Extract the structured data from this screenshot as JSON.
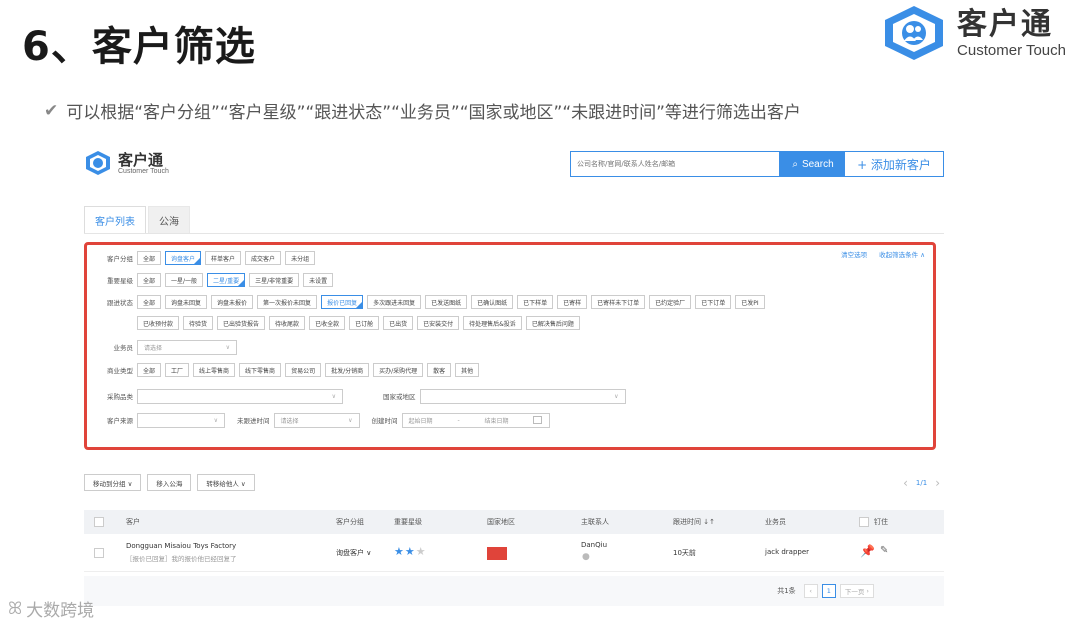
{
  "slide": {
    "title": "6、客户筛选",
    "subtitle": "可以根据“客户分组”“客户星级”“跟进状态”“业务员”“国家或地区”“未跟进时间”等进行筛选出客户",
    "brand_cn": "客户通",
    "brand_en": "Customer Touch",
    "watermark": "大数跨境"
  },
  "app": {
    "logo_cn": "客户通",
    "logo_en": "Customer Touch",
    "search_placeholder": "公司名称/官网/联系人姓名/邮箱",
    "search_button": "Search",
    "add_button": "+ 添加新客户",
    "tabs": [
      "客户列表",
      "公海"
    ],
    "links": {
      "clear": "清空选项",
      "collapse": "收起筛选条件 ∧"
    }
  },
  "filters": {
    "group": {
      "label": "客户分组",
      "options": [
        "全部",
        "询盘客户",
        "样单客户",
        "成交客户",
        "未分组"
      ],
      "selected": 1
    },
    "star": {
      "label": "重要星级",
      "options": [
        "全部",
        "一星/一般",
        "二星/重要",
        "三星/非常重要",
        "未设置"
      ],
      "selected": 2
    },
    "status": {
      "label": "跟进状态",
      "options1": [
        "全部",
        "询盘未回复",
        "询盘未报价",
        "第一次报价未回复",
        "报价已回复",
        "多次跟进未回复",
        "已发送图纸",
        "已确认图纸",
        "已下样单",
        "已寄样",
        "已寄样未下订单",
        "已约定验厂",
        "已下订单",
        "已发PI"
      ],
      "options2": [
        "已收预付款",
        "待验货",
        "已出验货报告",
        "待收尾款",
        "已收全款",
        "已订舱",
        "已出货",
        "已安装交付",
        "待处理售后&投诉",
        "已解决售后问题"
      ],
      "selected": 4
    },
    "sales": {
      "label": "业务员",
      "placeholder": "请选择"
    },
    "business": {
      "label": "商业类型",
      "options": [
        "全部",
        "工厂",
        "线上零售商",
        "线下零售商",
        "贸易公司",
        "批发/分销商",
        "买办/采购代理",
        "散客",
        "其他"
      ]
    },
    "purchase": {
      "label": "采购品类"
    },
    "country": {
      "label": "国家或地区"
    },
    "source": {
      "label": "客户来源"
    },
    "no_follow": {
      "label": "未跟进时间",
      "placeholder": "请选择"
    },
    "created": {
      "label": "创建时间",
      "start": "起始日期",
      "sep": "-",
      "end": "结束日期"
    }
  },
  "toolbar": {
    "move_group": "移动到分组 ∨",
    "move_public": "移入公海",
    "transfer": "转移给他人 ∨",
    "page": "1/1"
  },
  "table": {
    "headers": [
      "客户",
      "客户分组",
      "重要星级",
      "国家地区",
      "主联系人",
      "跟进时间 ↓↑",
      "业务员",
      "钉住"
    ],
    "row": {
      "company": "Dongguan Misaiou Toys Factory",
      "note": "［报价已回复］我的报价他已经回复了",
      "group": "询盘客户 ∨",
      "stars": 2,
      "contact": "DanQiu",
      "follow": "10天前",
      "sales": "jack drapper"
    },
    "footer": {
      "total": "共1条",
      "page": "1",
      "next": "下一页"
    }
  },
  "colors": {
    "accent": "#3a8ee6",
    "highlight": "#e0443a"
  }
}
